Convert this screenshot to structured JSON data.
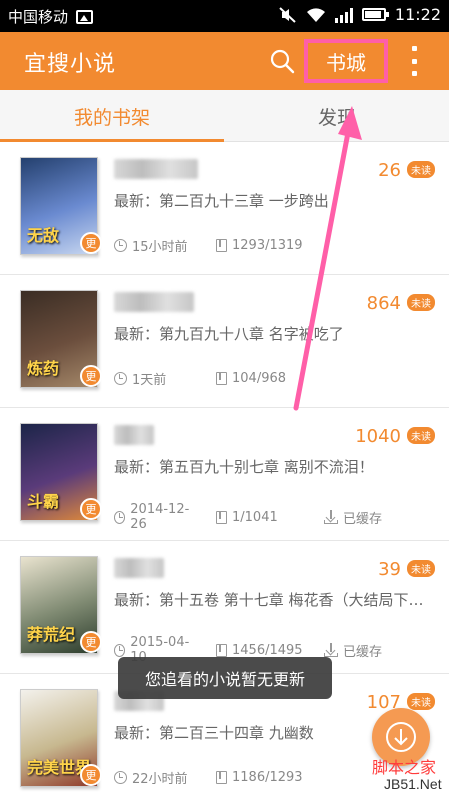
{
  "status_bar": {
    "carrier": "中国移动",
    "time": "11:22"
  },
  "app_bar": {
    "title": "宜搜小说",
    "store_label": "书城",
    "search_icon": "search-icon",
    "more_icon": "more-vertical-icon"
  },
  "tabs": [
    {
      "label": "我的书架",
      "active": true
    },
    {
      "label": "发现",
      "active": false
    }
  ],
  "books": [
    {
      "count": "26",
      "unread": "未读",
      "latest": "最新：第二百九十三章 一步跨出",
      "time": "15小时前",
      "progress": "1293/1319",
      "cached": "",
      "cover_text": "无敌",
      "cover_colors": [
        "#24406e",
        "#6a8ad0",
        "#c8d7f0"
      ]
    },
    {
      "count": "864",
      "unread": "未读",
      "latest": "最新：第九百九十八章 名字被吃了",
      "time": "1天前",
      "progress": "104/968",
      "cached": "",
      "cover_text": "炼药",
      "cover_colors": [
        "#3a2d24",
        "#6b4e3d",
        "#a5896a"
      ]
    },
    {
      "count": "1040",
      "unread": "未读",
      "latest": "最新：第五百九十别七章 离别不流泪！",
      "time": "2014-12-26",
      "progress": "1/1041",
      "cached": "已缓存",
      "cover_text": "斗霸",
      "cover_colors": [
        "#1c2548",
        "#5a3b7a",
        "#e08a3a"
      ]
    },
    {
      "count": "39",
      "unread": "未读",
      "latest": "最新：第十五卷 第十七章 梅花香（大结局下…",
      "time": "2015-04-10",
      "progress": "1456/1495",
      "cached": "已缓存",
      "cover_text": "莽荒纪",
      "cover_colors": [
        "#e9e3cf",
        "#7f8a72",
        "#2d3d2d"
      ]
    },
    {
      "count": "107",
      "unread": "未读",
      "latest": "最新：第二百三十四章 九幽数",
      "time": "22小时前",
      "progress": "1186/1293",
      "cached": "",
      "cover_text": "完美世界",
      "cover_colors": [
        "#f3f1ec",
        "#c7b88f",
        "#8f3a2a"
      ]
    }
  ],
  "cover_badge": "更",
  "toast": "您追看的小说暂无更新",
  "watermark": {
    "text": "脚本之家",
    "url": "JB51.Net"
  },
  "colors": {
    "accent": "#f28a30",
    "highlight": "#ff5fa8"
  }
}
